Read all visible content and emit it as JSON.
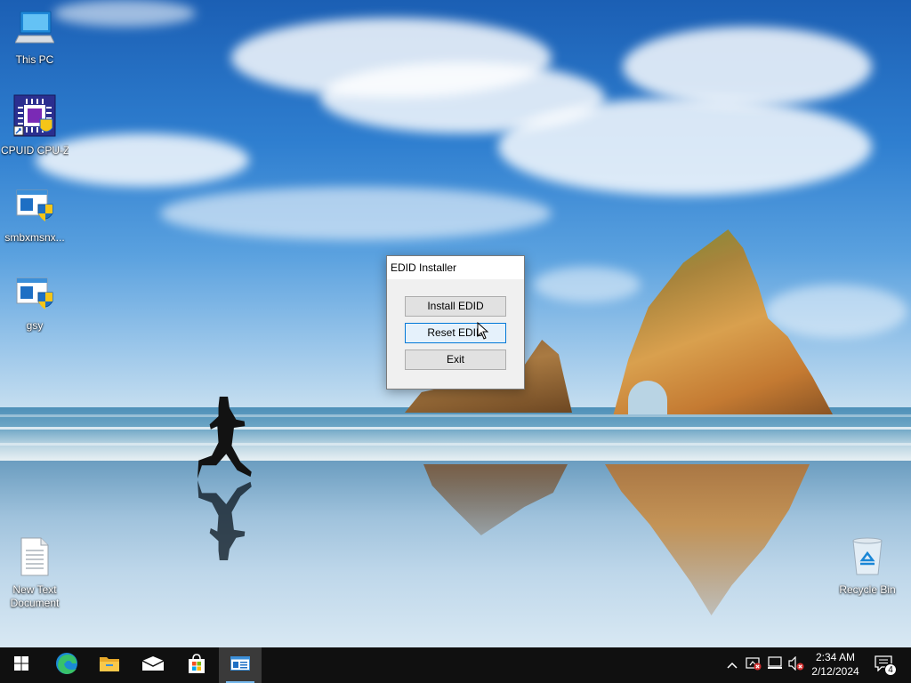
{
  "desktop": {
    "icons": [
      {
        "label": "This PC",
        "icon": "computer-icon"
      },
      {
        "label": "CPUID CPU-Z",
        "icon": "cpu-z-icon"
      },
      {
        "label": "smbxmsnx...",
        "icon": "installer-shield-icon"
      },
      {
        "label": "gsy",
        "icon": "installer-shield-icon"
      },
      {
        "label": "New Text Document",
        "icon": "text-document-icon"
      },
      {
        "label": "Recycle Bin",
        "icon": "recycle-bin-icon"
      }
    ]
  },
  "dialog": {
    "title": "EDID Installer",
    "buttons": {
      "install": "Install EDID",
      "reset": "Reset EDID",
      "exit": "Exit"
    },
    "hovered_button": "reset"
  },
  "taskbar": {
    "pinned": [
      {
        "name": "start",
        "icon": "windows-logo-icon"
      },
      {
        "name": "edge",
        "icon": "edge-icon"
      },
      {
        "name": "file-explorer",
        "icon": "folder-icon"
      },
      {
        "name": "mail",
        "icon": "mail-icon"
      },
      {
        "name": "store",
        "icon": "store-icon"
      },
      {
        "name": "edid-installer",
        "icon": "app-window-icon",
        "active": true
      }
    ],
    "tray": {
      "icons": [
        "chevron-up-icon",
        "security-warning-icon",
        "network-icon",
        "volume-muted-icon"
      ],
      "time": "2:34 AM",
      "date": "2/12/2024",
      "notification_count": "4"
    }
  },
  "colors": {
    "taskbar": "#101010",
    "accent": "#0078d7",
    "button_face": "#e1e1e1",
    "button_hover": "#e5f1fb"
  }
}
